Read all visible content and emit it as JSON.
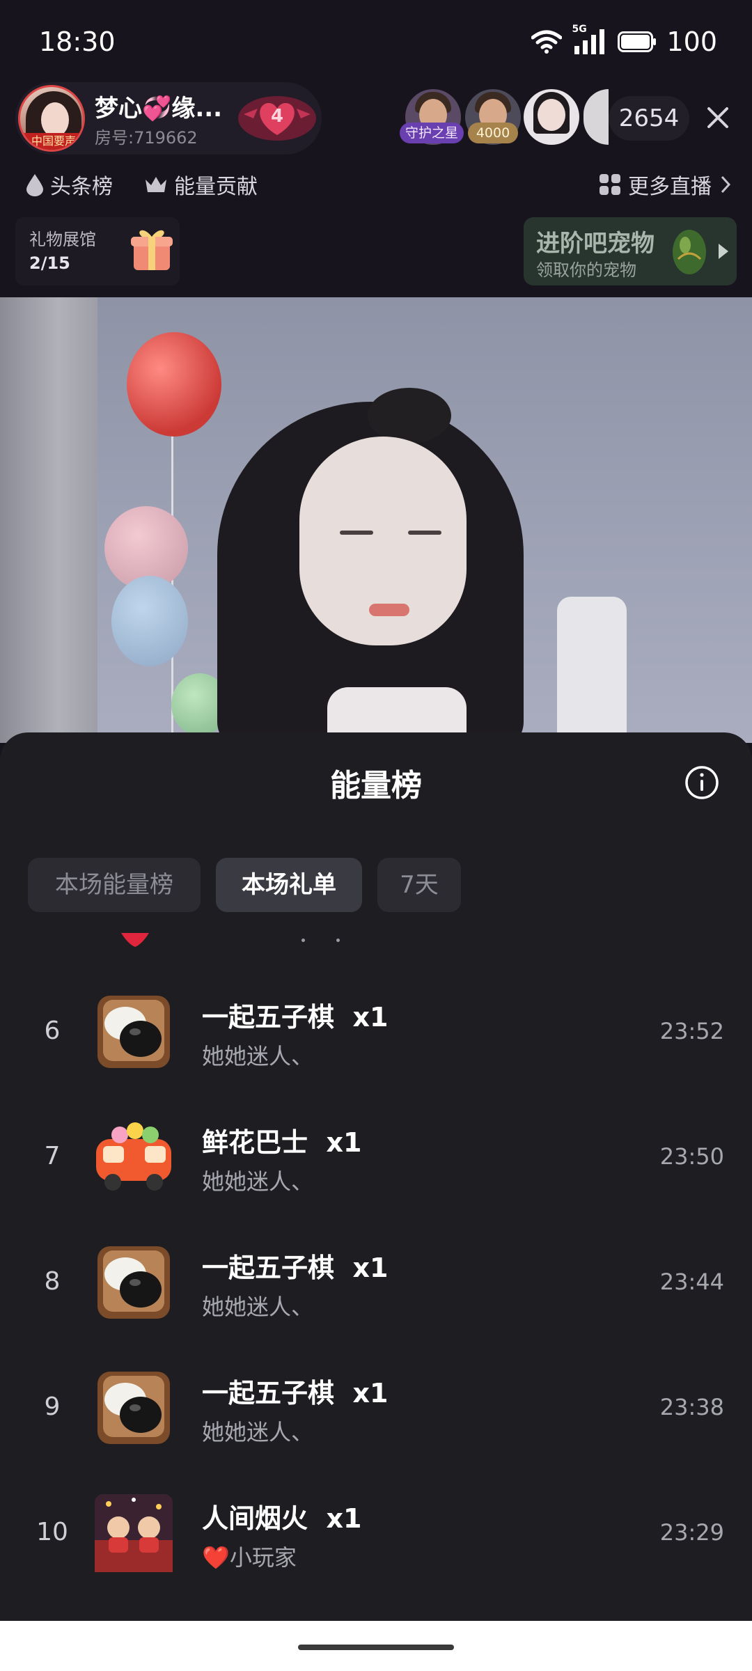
{
  "status_bar": {
    "time": "18:30",
    "network": "5G",
    "battery": "100"
  },
  "anchor": {
    "name": "梦心💞缘...",
    "room": "房号:719662",
    "avatar_tag": "中国要声",
    "heart_level": "4"
  },
  "viewers": {
    "guard_label": "守护之星",
    "score_badge": "4000",
    "count": "2654"
  },
  "chips": {
    "headline": "头条榜",
    "energy": "能量贡献",
    "more_live": "更多直播"
  },
  "gift_hall": {
    "label": "礼物展馆",
    "progress": "2/15"
  },
  "pet_banner": {
    "title": "进阶吧宠物",
    "subtitle": "领取你的宠物"
  },
  "sheet": {
    "title": "能量榜",
    "tabs": [
      {
        "label": "本场能量榜",
        "active": false
      },
      {
        "label": "本场礼单",
        "active": true
      },
      {
        "label": "7天",
        "active": false
      }
    ],
    "rows": [
      {
        "rank": "6",
        "gift": "一起五子棋",
        "qty": "x1",
        "sender": "她她迷人、",
        "time": "23:52",
        "icon": "gomoku-icon"
      },
      {
        "rank": "7",
        "gift": "鲜花巴士",
        "qty": "x1",
        "sender": "她她迷人、",
        "time": "23:50",
        "icon": "flower-bus-icon"
      },
      {
        "rank": "8",
        "gift": "一起五子棋",
        "qty": "x1",
        "sender": "她她迷人、",
        "time": "23:44",
        "icon": "gomoku-icon"
      },
      {
        "rank": "9",
        "gift": "一起五子棋",
        "qty": "x1",
        "sender": "她她迷人、",
        "time": "23:38",
        "icon": "gomoku-icon"
      },
      {
        "rank": "10",
        "gift": "人间烟火",
        "qty": "x1",
        "sender": "❤️小玩家",
        "time": "23:29",
        "icon": "fireworks-feast-icon"
      }
    ]
  }
}
